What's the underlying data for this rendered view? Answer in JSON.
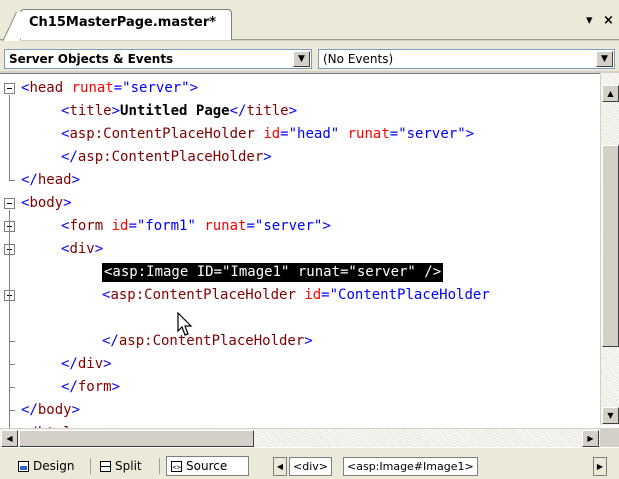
{
  "tab": {
    "title": "Ch15MasterPage.master*"
  },
  "tab_controls": {
    "dropdown_glyph": "▾",
    "close_glyph": "×"
  },
  "dropdowns": {
    "objects": "Server Objects & Events",
    "events": "(No Events)"
  },
  "code_lines": [
    {
      "indent": 0,
      "tokens": [
        [
          "b",
          "<"
        ],
        [
          "m",
          "head"
        ],
        [
          "b",
          " "
        ],
        [
          "r",
          "runat"
        ],
        [
          "b",
          "=\"server\">"
        ]
      ]
    },
    {
      "indent": 1,
      "tokens": [
        [
          "b",
          "<"
        ],
        [
          "m",
          "title"
        ],
        [
          "b",
          ">"
        ],
        [
          "k",
          "Untitled Page"
        ],
        [
          "b",
          "</"
        ],
        [
          "m",
          "title"
        ],
        [
          "b",
          ">"
        ]
      ]
    },
    {
      "indent": 1,
      "tokens": [
        [
          "b",
          "<"
        ],
        [
          "m",
          "asp:ContentPlaceHolder"
        ],
        [
          "b",
          " "
        ],
        [
          "r",
          "id"
        ],
        [
          "b",
          "=\"head\" "
        ],
        [
          "r",
          "runat"
        ],
        [
          "b",
          "=\"server\">"
        ]
      ]
    },
    {
      "indent": 1,
      "tokens": [
        [
          "b",
          "</"
        ],
        [
          "m",
          "asp:ContentPlaceHolder"
        ],
        [
          "b",
          ">"
        ]
      ]
    },
    {
      "indent": 0,
      "tokens": [
        [
          "b",
          "</"
        ],
        [
          "m",
          "head"
        ],
        [
          "b",
          ">"
        ]
      ]
    },
    {
      "indent": 0,
      "tokens": [
        [
          "b",
          "<"
        ],
        [
          "m",
          "body"
        ],
        [
          "b",
          ">"
        ]
      ]
    },
    {
      "indent": 1,
      "tokens": [
        [
          "b",
          "<"
        ],
        [
          "m",
          "form"
        ],
        [
          "b",
          " "
        ],
        [
          "r",
          "id"
        ],
        [
          "b",
          "=\"form1\" "
        ],
        [
          "r",
          "runat"
        ],
        [
          "b",
          "=\"server\">"
        ]
      ]
    },
    {
      "indent": 1,
      "tokens": [
        [
          "b",
          "<"
        ],
        [
          "m",
          "div"
        ],
        [
          "b",
          ">"
        ]
      ]
    },
    {
      "indent": 2,
      "selected": true,
      "text": "<asp:Image ID=\"Image1\" runat=\"server\" />"
    },
    {
      "indent": 2,
      "tokens": [
        [
          "b",
          "<"
        ],
        [
          "m",
          "asp:ContentPlaceHolder"
        ],
        [
          "b",
          " "
        ],
        [
          "r",
          "id"
        ],
        [
          "b",
          "=\"ContentPlaceHolder"
        ]
      ]
    },
    {
      "indent": 2,
      "tokens": []
    },
    {
      "indent": 2,
      "tokens": [
        [
          "b",
          "</"
        ],
        [
          "m",
          "asp:ContentPlaceHolder"
        ],
        [
          "b",
          ">"
        ]
      ]
    },
    {
      "indent": 1,
      "tokens": [
        [
          "b",
          "</"
        ],
        [
          "m",
          "div"
        ],
        [
          "b",
          ">"
        ]
      ]
    },
    {
      "indent": 1,
      "tokens": [
        [
          "b",
          "</"
        ],
        [
          "m",
          "form"
        ],
        [
          "b",
          ">"
        ]
      ]
    },
    {
      "indent": 0,
      "tokens": [
        [
          "b",
          "</"
        ],
        [
          "m",
          "body"
        ],
        [
          "b",
          ">"
        ]
      ]
    },
    {
      "indent": 0,
      "tokens": [
        [
          "b",
          "</"
        ],
        [
          "m",
          "html"
        ],
        [
          "b",
          ">"
        ]
      ]
    }
  ],
  "colors": {
    "tag_bracket": "#0000ff",
    "tag_name": "#800000",
    "attribute": "#ff0000",
    "selection_bg": "#000000"
  },
  "view_buttons": {
    "design": "Design",
    "split": "Split",
    "source": "Source"
  },
  "breadcrumbs": [
    "<div>",
    "<asp:Image#Image1>"
  ],
  "scroll_arrows": {
    "up": "▲",
    "down": "▼",
    "left": "◀",
    "right": "▶"
  }
}
